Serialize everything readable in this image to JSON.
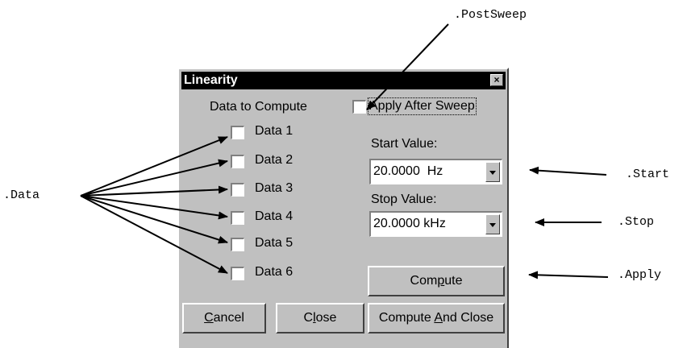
{
  "window": {
    "title": "Linearity",
    "close_glyph": "×"
  },
  "data_section": {
    "heading": "Data to Compute",
    "items": [
      "Data 1",
      "Data 2",
      "Data 3",
      "Data 4",
      "Data 5",
      "Data 6"
    ]
  },
  "post_sweep": {
    "label": "Apply After Sweep",
    "checked": false
  },
  "start": {
    "label": "Start Value:",
    "value": "20.0000  Hz"
  },
  "stop": {
    "label": "Stop Value:",
    "value": "20.0000 kHz"
  },
  "buttons": {
    "compute": {
      "pre": "Com",
      "accel": "p",
      "post": "ute"
    },
    "cancel": {
      "pre": "",
      "accel": "C",
      "post": "ancel"
    },
    "close": {
      "pre": "C",
      "accel": "l",
      "post": "ose"
    },
    "compute_close": {
      "pre": "Compute ",
      "accel": "A",
      "post": "nd Close"
    }
  },
  "callouts": {
    "post_sweep": ".PostSweep",
    "data": ".Data",
    "start": ".Start",
    "stop": ".Stop",
    "apply": ".Apply"
  }
}
